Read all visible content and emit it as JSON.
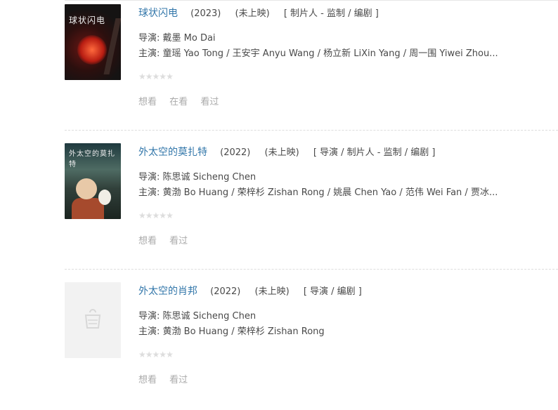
{
  "movies": [
    {
      "title": "球状闪电",
      "year": "(2023)",
      "status": "(未上映)",
      "roles": "[ 制片人 - 监制 / 编剧 ]",
      "director": "导演: 戴墨 Mo Dai",
      "cast": "主演: 童瑶 Yao Tong / 王安宇 Anyu Wang / 杨立新 LiXin Yang / 周一围 Yiwei Zhou...",
      "poster_text": "球状闪电",
      "actions": [
        "想看",
        "在看",
        "看过"
      ]
    },
    {
      "title": "外太空的莫扎特",
      "year": "(2022)",
      "status": "(未上映)",
      "roles": "[ 导演 / 制片人 - 监制 / 编剧 ]",
      "director": "导演: 陈思诚 Sicheng Chen",
      "cast": "主演: 黄渤 Bo Huang / 荣梓杉 Zishan Rong / 姚晨 Chen Yao / 范伟 Wei Fan / 贾冰...",
      "poster_text": "外太空的莫扎特",
      "actions": [
        "想看",
        "看过"
      ]
    },
    {
      "title": "外太空的肖邦",
      "year": "(2022)",
      "status": "(未上映)",
      "roles": "[ 导演 / 编剧 ]",
      "director": "导演: 陈思诚 Sicheng Chen",
      "cast": "主演: 黄渤 Bo Huang / 荣梓杉 Zishan Rong",
      "actions": [
        "想看",
        "看过"
      ]
    }
  ],
  "rating_stars": 5,
  "colors": {
    "title": "#3377aa",
    "star_empty": "#dddddd",
    "action": "#aaaaaa"
  }
}
